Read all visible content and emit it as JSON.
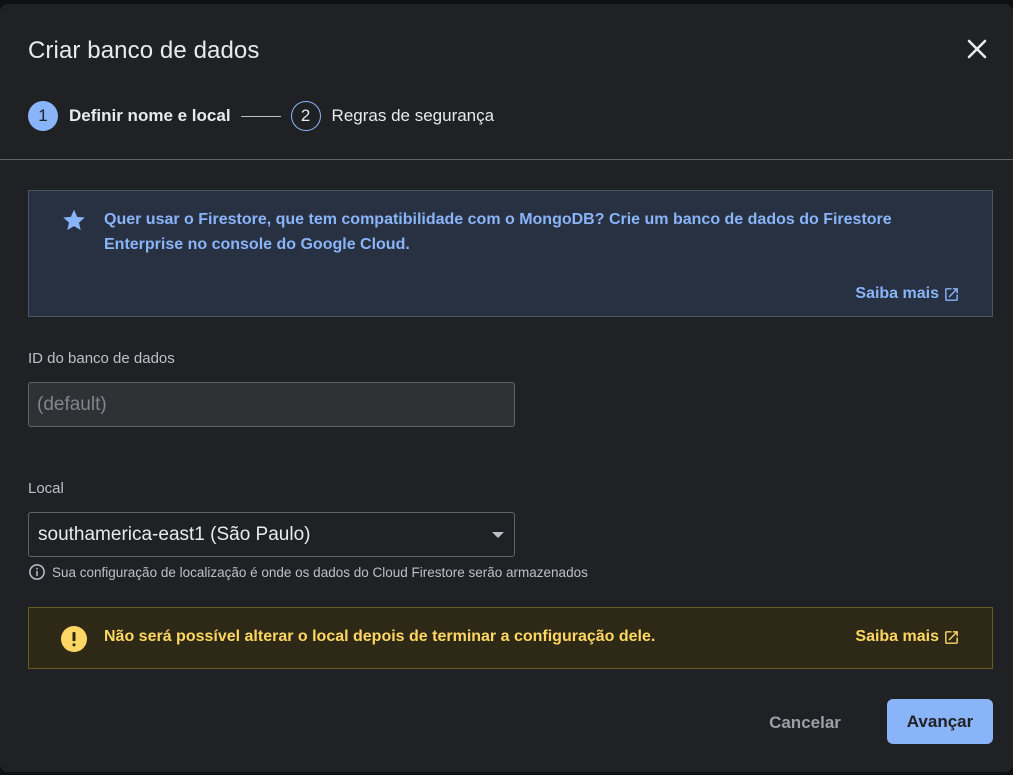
{
  "dialog": {
    "title": "Criar banco de dados"
  },
  "stepper": {
    "steps": [
      {
        "number": "1",
        "label": "Definir nome e local",
        "active": true
      },
      {
        "number": "2",
        "label": "Regras de segurança",
        "active": false
      }
    ]
  },
  "info_banner": {
    "icon": "star-icon",
    "text": "Quer usar o Firestore, que tem compatibilidade com o MongoDB? Crie um banco de dados do Firestore Enterprise no console do Google Cloud.",
    "link_label": "Saiba mais"
  },
  "database_id": {
    "label": "ID do banco de dados",
    "value": "",
    "placeholder": "(default)"
  },
  "location": {
    "label": "Local",
    "selected": "southamerica-east1 (São Paulo)",
    "helper": "Sua configuração de localização é onde os dados do Cloud Firestore serão armazenados"
  },
  "warning_banner": {
    "icon": "warning-icon",
    "text": "Não será possível alterar o local depois de terminar a configuração dele.",
    "link_label": "Saiba mais"
  },
  "footer": {
    "cancel_label": "Cancelar",
    "next_label": "Avançar"
  },
  "colors": {
    "accent": "#8ab4f8",
    "warning": "#fdd663",
    "background": "#202124"
  }
}
